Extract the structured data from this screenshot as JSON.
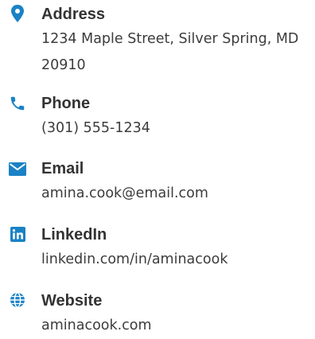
{
  "colors": {
    "accent": "#1a82c5",
    "label": "#333333",
    "value": "#3c3c3c"
  },
  "contacts": [
    {
      "label": "Address",
      "value": "1234 Maple Street, Silver Spring, MD 20910",
      "icon": "map-pin-icon"
    },
    {
      "label": "Phone",
      "value": "(301) 555-1234",
      "icon": "phone-icon"
    },
    {
      "label": "Email",
      "value": "amina.cook@email.com",
      "icon": "envelope-icon"
    },
    {
      "label": "LinkedIn",
      "value": "linkedin.com/in/aminacook",
      "icon": "linkedin-icon"
    },
    {
      "label": "Website",
      "value": "aminacook.com",
      "icon": "globe-icon"
    }
  ]
}
